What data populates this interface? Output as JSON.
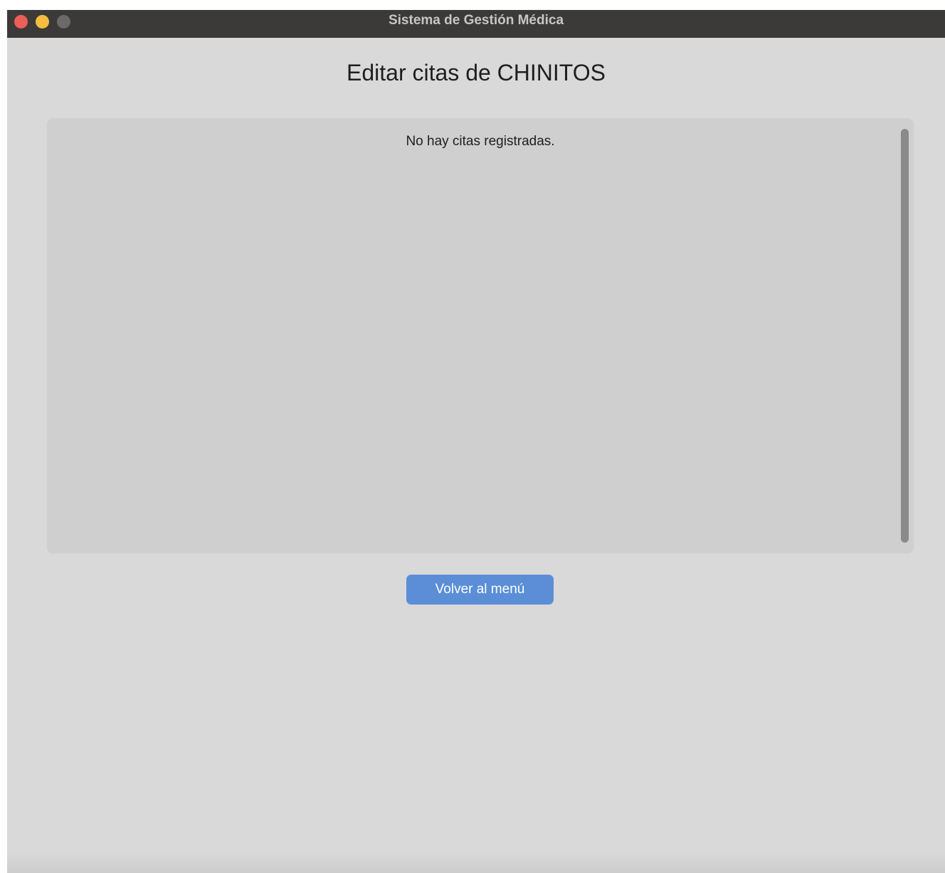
{
  "window": {
    "title": "Sistema de Gestión Médica",
    "controls": {
      "close_icon": "traffic-light-close",
      "minimize_icon": "traffic-light-minimize",
      "zoom_icon": "traffic-light-zoom"
    }
  },
  "main": {
    "title": "Editar citas de CHINITOS",
    "appointments": {
      "empty_message": "No hay citas registradas."
    },
    "back_button_label": "Volver al menú"
  },
  "colors": {
    "titlebar": "#3c3a38",
    "background": "#d9d9d9",
    "panel": "#cfcfcf",
    "accent": "#5b8ed6",
    "close": "#ec5f58",
    "minimize": "#f4bd3f",
    "zoom": "#6b6a69"
  }
}
